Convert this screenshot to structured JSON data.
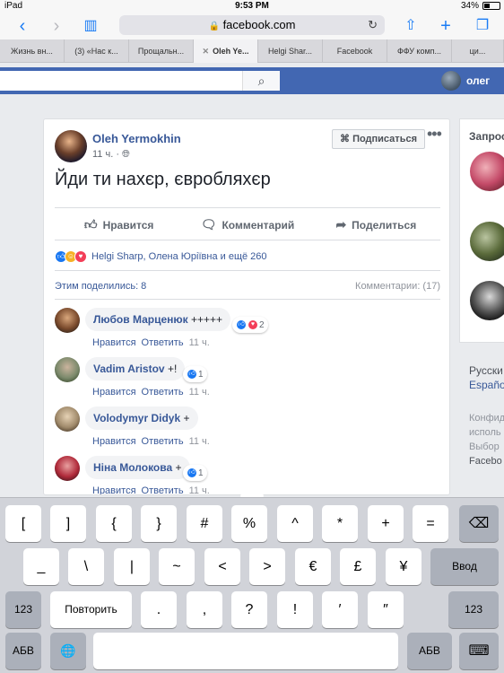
{
  "status_bar": {
    "device": "iPad",
    "time": "9:53 PM",
    "battery": "34%"
  },
  "browser": {
    "url": "facebook.com",
    "tabs": [
      "Жизнь вн...",
      "(3) «Нас к...",
      "Прощальн...",
      "Oleh Ye...",
      "Helgi Shar...",
      "Facebook",
      "ФФУ комп...",
      "ци..."
    ],
    "active_tab": 3
  },
  "fb": {
    "user_name": "олег"
  },
  "post": {
    "author": "Oleh Yermokhin",
    "time": "11 ч.",
    "subscribe_label": "Подписаться",
    "text": "Йди ти нахєр, євробляхєр",
    "actions": {
      "like": "Нравится",
      "comment": "Комментарий",
      "share": "Поделиться"
    },
    "reactions_text": "Helgi Sharp, Олена Юріївна и ещё 260",
    "shared_text": "Этим поделились: 8",
    "comments_count_text": "Комментарии: (17)",
    "comments": [
      {
        "name": "Любов Марценюк",
        "text": "+++++",
        "reaction_count": "2",
        "like_label": "Нравится",
        "reply_label": "Ответить",
        "time": "11 ч."
      },
      {
        "name": "Vadim Aristov",
        "text": "+!",
        "reaction_count": "1",
        "like_label": "Нравится",
        "reply_label": "Ответить",
        "time": "11 ч."
      },
      {
        "name": "Volodymyr Didyk",
        "text": "+",
        "reaction_count": "",
        "like_label": "Нравится",
        "reply_label": "Ответить",
        "time": "11 ч."
      },
      {
        "name": "Ніна Молокова",
        "text": "+",
        "reaction_count": "1",
        "like_label": "Нравится",
        "reply_label": "Ответить",
        "time": "11 ч."
      }
    ]
  },
  "sidebar": {
    "title": "Запрос",
    "languages": [
      "Русски",
      "Españo"
    ],
    "footer": [
      "Конфид",
      "исполь",
      "Выбор",
      "Facebo"
    ]
  },
  "keyboard": {
    "row1": [
      "[",
      "]",
      "{",
      "}",
      "#",
      "%",
      "^",
      "*",
      "+",
      "="
    ],
    "row2": [
      "_",
      "\\",
      "|",
      "~",
      "<",
      ">",
      "€",
      "£",
      "¥"
    ],
    "row3": [
      ".",
      ",",
      "?",
      "!",
      "′",
      "″"
    ],
    "return_label": "Ввод",
    "num_label": "123",
    "redo_label": "Повторить",
    "abc_label": "АБВ",
    "backspace_icon": "⌫",
    "globe_icon": "🌐",
    "hide_icon": "⌨"
  },
  "colors": {
    "fb_blue": "#4267b2",
    "link_blue": "#385898",
    "ios_blue": "#1a7cf5"
  }
}
